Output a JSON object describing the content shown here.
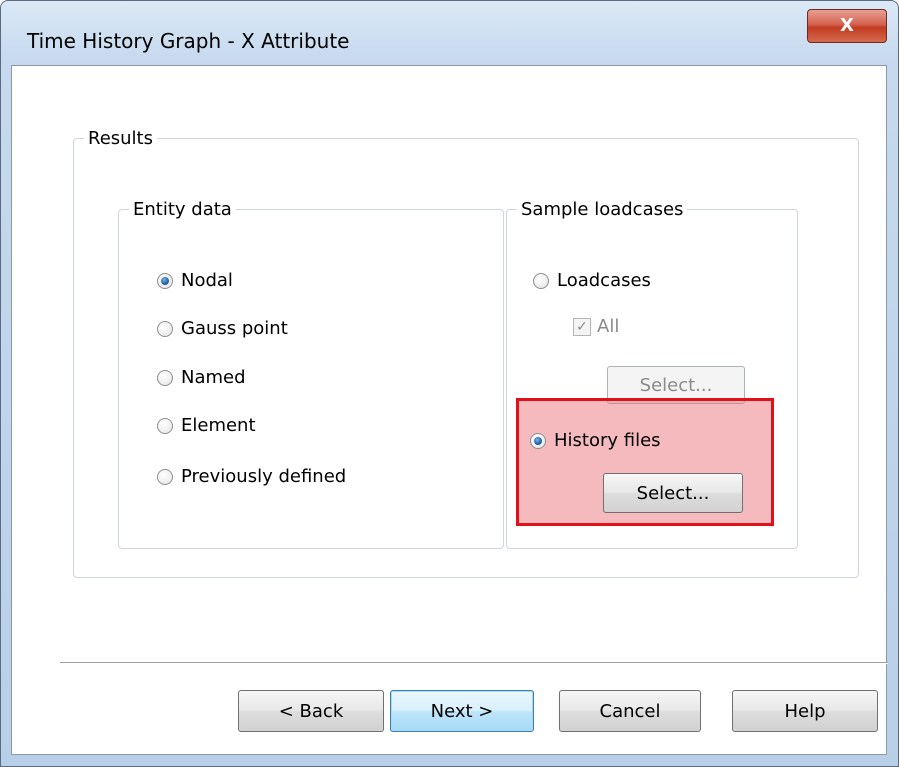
{
  "window": {
    "title": "Time History Graph - X Attribute",
    "close_glyph": "X"
  },
  "results": {
    "legend": "Results",
    "entity_data": {
      "legend": "Entity data",
      "options": [
        {
          "label": "Nodal",
          "checked": true
        },
        {
          "label": "Gauss point",
          "checked": false
        },
        {
          "label": "Named",
          "checked": false
        },
        {
          "label": "Element",
          "checked": false
        },
        {
          "label": "Previously defined",
          "checked": false
        }
      ]
    },
    "sample_loadcases": {
      "legend": "Sample loadcases",
      "loadcases_label": "Loadcases",
      "all_label": "All",
      "all_checkmark": "✓",
      "loadcases_select_label": "Select...",
      "history_files_label": "History files",
      "history_select_label": "Select..."
    }
  },
  "footer": {
    "back_label": "< Back",
    "next_label": "Next >",
    "cancel_label": "Cancel",
    "help_label": "Help"
  },
  "colors": {
    "highlight_border": "#e3101a",
    "highlight_fill": "#f0a0a6",
    "default_button_border": "#3c7fb1"
  }
}
